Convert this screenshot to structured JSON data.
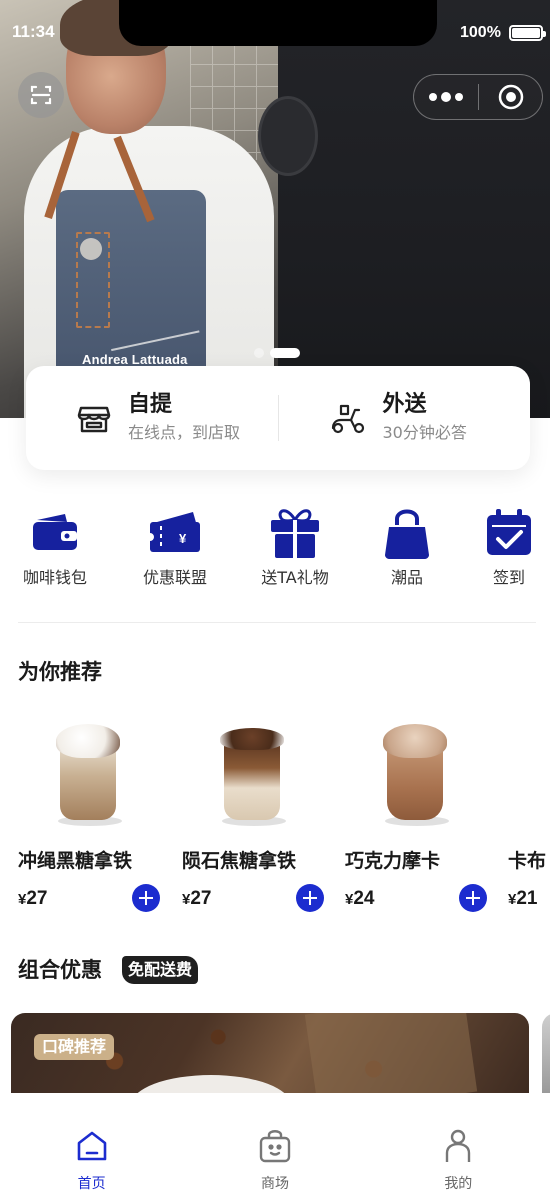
{
  "status_bar": {
    "time": "11:34",
    "battery": "100%"
  },
  "hero": {
    "caption": "Andrea Lattuada",
    "slides": 2,
    "active_slide": 2
  },
  "order_modes": [
    {
      "title": "自提",
      "subtitle": "在线点，到店取",
      "icon": "storefront-icon"
    },
    {
      "title": "外送",
      "subtitle": "30分钟必答",
      "icon": "scooter-icon"
    }
  ],
  "quick_menu": [
    {
      "label": "咖啡钱包",
      "icon": "wallet-icon"
    },
    {
      "label": "优惠联盟",
      "icon": "coupon-icon"
    },
    {
      "label": "送TA礼物",
      "icon": "gift-icon"
    },
    {
      "label": "潮品",
      "icon": "bag-icon"
    },
    {
      "label": "签到",
      "icon": "calendar-check-icon"
    }
  ],
  "recommend": {
    "title": "为你推荐",
    "items": [
      {
        "name": "冲绳黑糖拿铁",
        "currency": "¥",
        "price": "27"
      },
      {
        "name": "陨石焦糖拿铁",
        "currency": "¥",
        "price": "27"
      },
      {
        "name": "巧克力摩卡",
        "currency": "¥",
        "price": "24"
      },
      {
        "name": "卡布",
        "currency": "¥",
        "price": "21"
      }
    ]
  },
  "combo": {
    "title": "组合优惠",
    "badge": "免配送费",
    "card_tag": "口碑推荐"
  },
  "tabs": [
    {
      "label": "首页",
      "icon": "home-icon",
      "active": true
    },
    {
      "label": "商场",
      "icon": "shopping-bag-icon",
      "active": false
    },
    {
      "label": "我的",
      "icon": "profile-icon",
      "active": false
    }
  ],
  "colors": {
    "accent": "#1c2ccf",
    "icon_navy": "#16219e"
  }
}
